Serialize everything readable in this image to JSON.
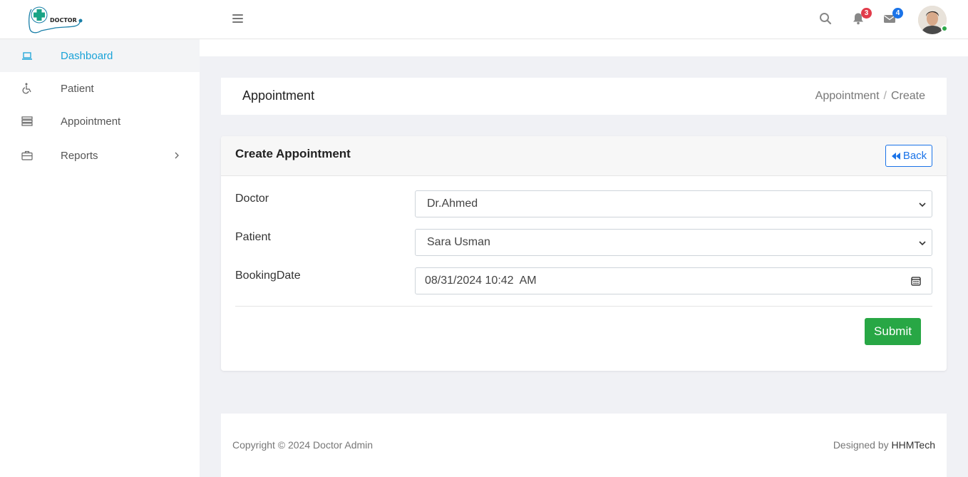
{
  "brand": {
    "logo_text": "DOCTOR"
  },
  "header": {
    "notifications_count": "3",
    "messages_count": "4"
  },
  "sidebar": {
    "items": [
      {
        "label": "Dashboard",
        "icon": "laptop-icon",
        "active": true
      },
      {
        "label": "Patient",
        "icon": "wheelchair-icon"
      },
      {
        "label": "Appointment",
        "icon": "server-icon"
      },
      {
        "label": "Reports",
        "icon": "briefcase-icon",
        "has_submenu": true
      }
    ]
  },
  "page": {
    "title": "Appointment",
    "breadcrumb": [
      "Appointment",
      "Create"
    ]
  },
  "form": {
    "title": "Create Appointment",
    "back_label": "Back",
    "fields": [
      {
        "label": "Doctor",
        "value": "Dr.Ahmed",
        "type": "select"
      },
      {
        "label": "Patient",
        "value": "Sara Usman",
        "type": "select"
      },
      {
        "label": "BookingDate",
        "value": "08/31/2024 10:42  AM",
        "type": "datetime"
      }
    ],
    "submit_label": "Submit"
  },
  "footer": {
    "copyright": "Copyright © 2024 Doctor Admin",
    "designed_by": "Designed by",
    "designer": "HHMTech"
  },
  "colors": {
    "accent": "#1aa3d8",
    "primary": "#1a73e8",
    "success": "#28a745",
    "danger": "#e23b4a",
    "page_bg": "#f0f1f5"
  }
}
